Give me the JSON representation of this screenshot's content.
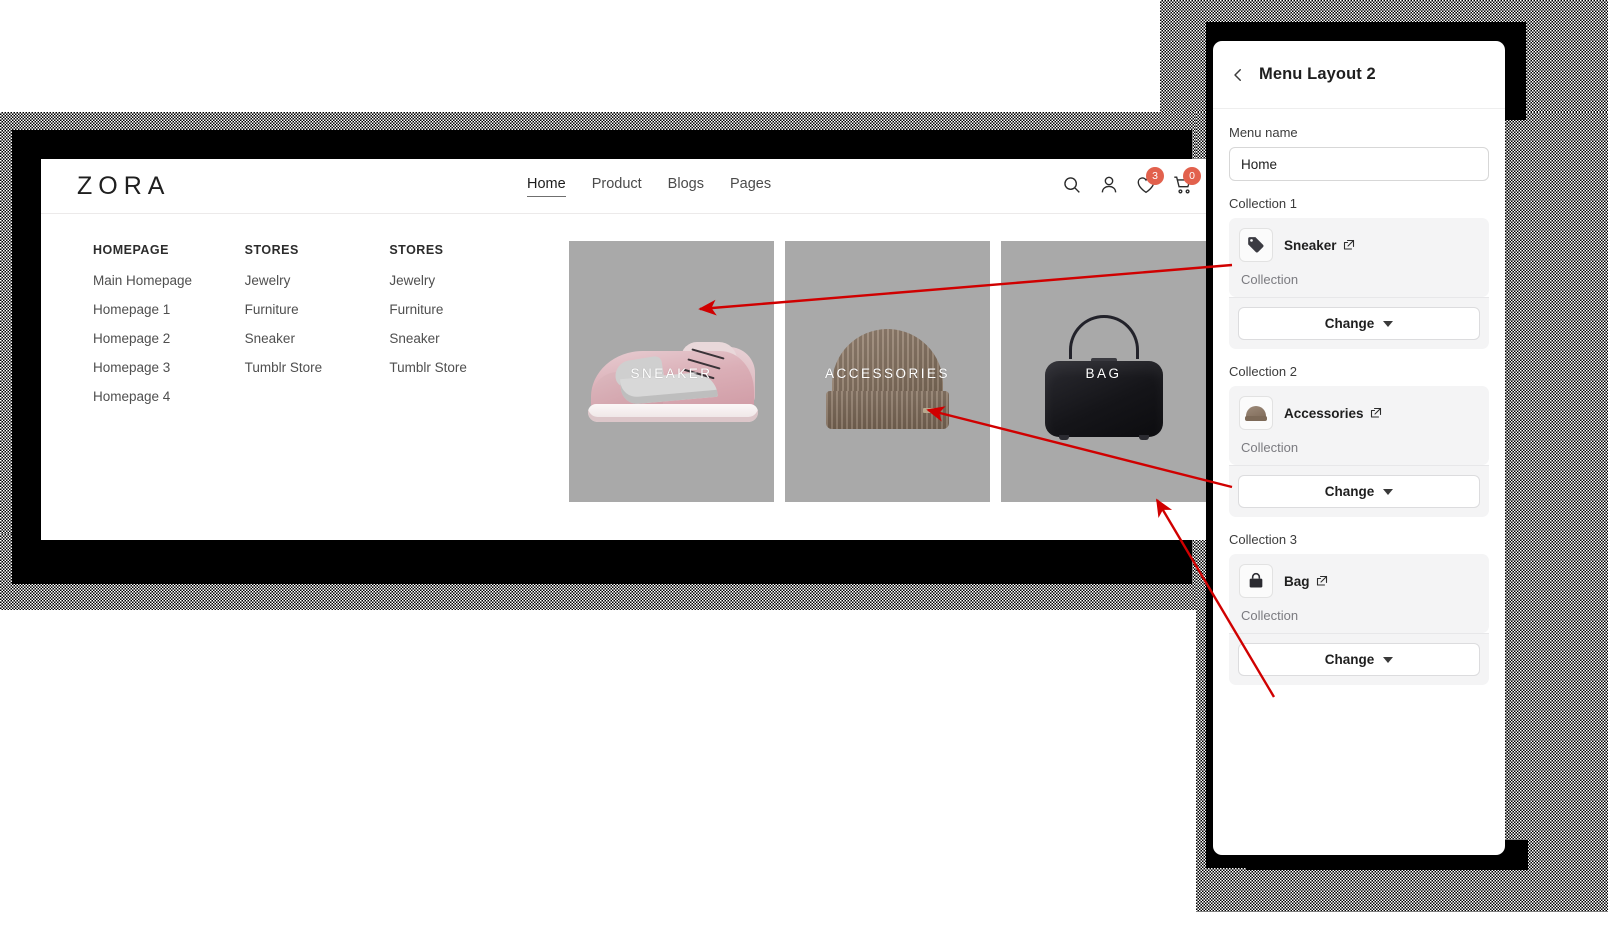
{
  "storefront": {
    "logo": "ZORA",
    "nav": [
      {
        "label": "Home",
        "active": true
      },
      {
        "label": "Product",
        "active": false
      },
      {
        "label": "Blogs",
        "active": false
      },
      {
        "label": "Pages",
        "active": false
      }
    ],
    "icons": [
      {
        "name": "search-icon",
        "badge": null
      },
      {
        "name": "account-icon",
        "badge": null
      },
      {
        "name": "wishlist-heart-icon",
        "badge": "3"
      },
      {
        "name": "cart-icon",
        "badge": "0"
      }
    ],
    "mega_menu": {
      "columns": [
        {
          "title": "HOMEPAGE",
          "links": [
            "Main Homepage",
            "Homepage 1",
            "Homepage 2",
            "Homepage 3",
            "Homepage 4"
          ]
        },
        {
          "title": "STORES",
          "links": [
            "Jewelry",
            "Furniture",
            "Sneaker",
            "Tumblr Store"
          ]
        },
        {
          "title": "STORES",
          "links": [
            "Jewelry",
            "Furniture",
            "Sneaker",
            "Tumblr Store"
          ]
        }
      ],
      "cards": [
        {
          "caption": "SNEAKER",
          "art": "sneaker"
        },
        {
          "caption": "ACCESSORIES",
          "art": "beanie"
        },
        {
          "caption": "BAG",
          "art": "bag"
        }
      ]
    }
  },
  "panel": {
    "back_icon": "chevron-left-icon",
    "title": "Menu Layout 2",
    "menu_name_label": "Menu name",
    "menu_name_value": "Home",
    "menu_name_placeholder": "Menu name",
    "collections": [
      {
        "section_label": "Collection 1",
        "name": "Sneaker",
        "type": "Collection",
        "thumb": "tag-icon",
        "external_icon": "external-link-icon",
        "change_label": "Change"
      },
      {
        "section_label": "Collection 2",
        "name": "Accessories",
        "type": "Collection",
        "thumb": "beanie-thumbnail",
        "external_icon": "external-link-icon",
        "change_label": "Change"
      },
      {
        "section_label": "Collection 3",
        "name": "Bag",
        "type": "Collection",
        "thumb": "handbag-icon",
        "external_icon": "external-link-icon",
        "change_label": "Change"
      }
    ]
  },
  "colors": {
    "badge": "#e2614d",
    "card_background": "#a9a9a9",
    "arrow": "#d00000",
    "panel_card": "#f4f4f5"
  },
  "annotations": {
    "arrows": [
      {
        "from": "collection-1-row",
        "to": "sneaker-card"
      },
      {
        "from": "collection-2-row",
        "to": "accessories-card"
      },
      {
        "from": "collection-3-row",
        "to": "bag-card"
      }
    ]
  }
}
